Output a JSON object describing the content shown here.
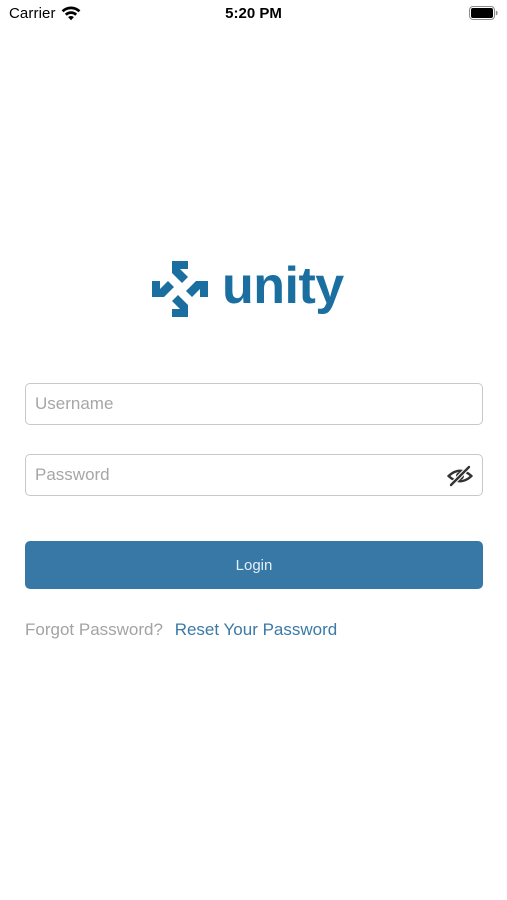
{
  "status_bar": {
    "carrier": "Carrier",
    "time": "5:20 PM"
  },
  "logo": {
    "wordmark": "unity",
    "color": "#1a6fa0"
  },
  "form": {
    "username_placeholder": "Username",
    "password_placeholder": "Password",
    "username_value": "",
    "password_value": ""
  },
  "login_button": {
    "label": "Login",
    "color": "#3778a6"
  },
  "forgot": {
    "prompt": "Forgot Password?",
    "link_label": "Reset Your Password"
  },
  "icons": {
    "wifi": "wifi-icon",
    "battery": "battery-icon",
    "password_toggle": "eye-slash-icon"
  }
}
